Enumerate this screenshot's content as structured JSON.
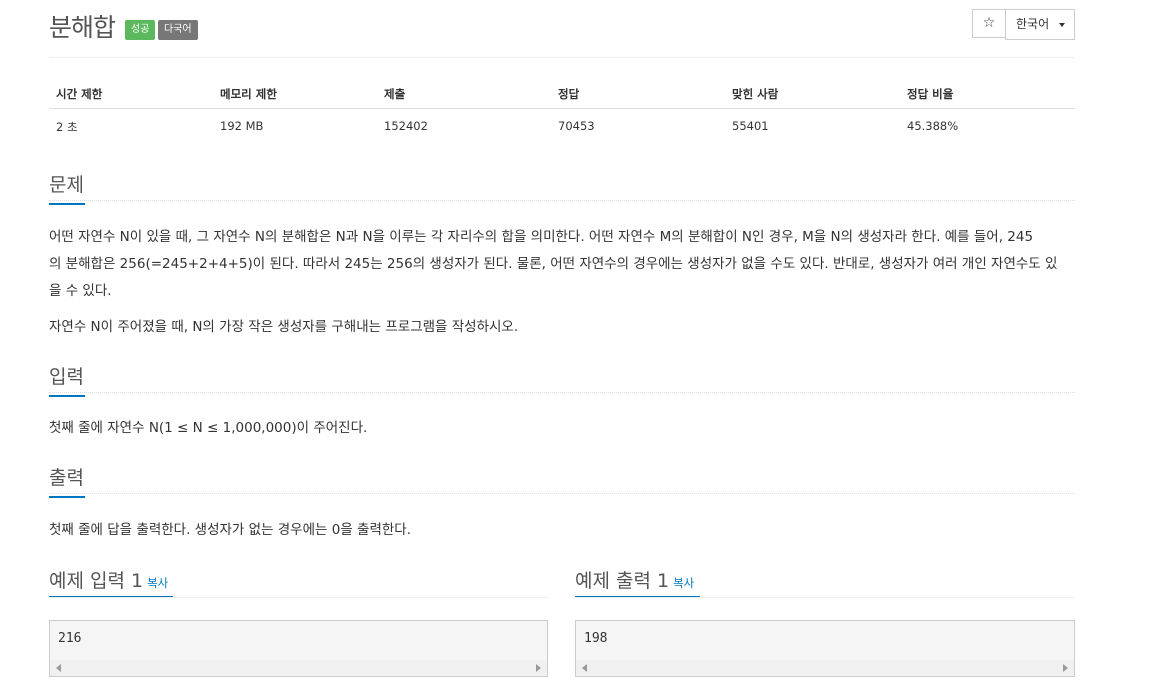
{
  "problem": {
    "title": "분해합",
    "badge_success": "성공",
    "badge_lang": "다국어",
    "star": "☆",
    "lang_select": "한국어"
  },
  "info": {
    "headers": [
      "시간 제한",
      "메모리 제한",
      "제출",
      "정답",
      "맞힌 사람",
      "정답 비율"
    ],
    "values": [
      "2 초",
      "192 MB",
      "152402",
      "70453",
      "55401",
      "45.388%"
    ]
  },
  "sections": {
    "problem_title": "문제",
    "problem_p1_l1": "어떤 자연수 N이 있을 때, 그 자연수 N의 분해합은 N과 N을 이루는 각 자리수의 합을 의미한다. 어떤 자연수 M의 분해합이 N인 경우, M을 N의 생성자라 한다. 예를 들어, 245",
    "problem_p1_l2": "의 분해합은 256(=245+2+4+5)이 된다. 따라서 245는 256의 생성자가 된다. 물론, 어떤 자연수의 경우에는 생성자가 없을 수도 있다. 반대로, 생성자가 여러 개인 자연수도 있",
    "problem_p1_l3": "을 수 있다.",
    "problem_p2": "자연수 N이 주어졌을 때, N의 가장 작은 생성자를 구해내는 프로그램을 작성하시오.",
    "input_title": "입력",
    "input_text": "첫째 줄에 자연수 N(1 ≤ N ≤ 1,000,000)이 주어진다.",
    "output_title": "출력",
    "output_text": "첫째 줄에 답을 출력한다. 생성자가 없는 경우에는 0을 출력한다."
  },
  "samples": {
    "input_title": "예제 입력 1",
    "output_title": "예제 출력 1",
    "copy_label": "복사",
    "input_value": "216",
    "output_value": "198"
  },
  "colors": {
    "accent": "#0076c0",
    "success": "#5cb85c",
    "gray_badge": "#777777"
  }
}
